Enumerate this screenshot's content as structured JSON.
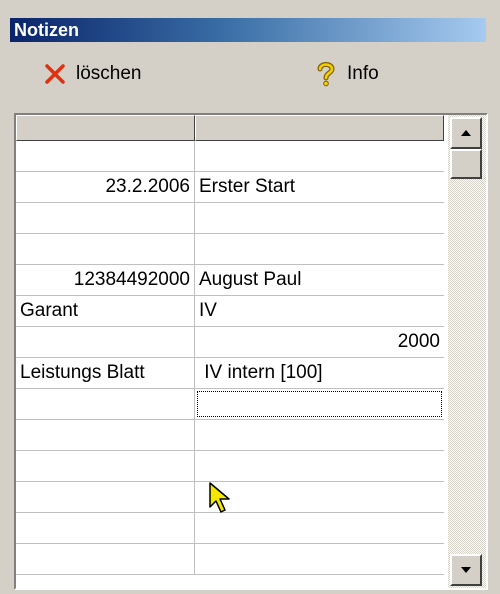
{
  "window": {
    "title": "Notizen"
  },
  "toolbar": {
    "delete_label": "löschen",
    "delete_icon": "delete-x-icon",
    "info_label": "Info",
    "info_icon": "question-mark-icon"
  },
  "grid": {
    "rows": [
      {
        "col1": "",
        "col2": ""
      },
      {
        "col1": "23.2.2006",
        "col2": "Erster Start"
      },
      {
        "col1": "",
        "col2": ""
      },
      {
        "col1": "",
        "col2": ""
      },
      {
        "col1": "12384492000",
        "col2": "August Paul"
      },
      {
        "col1": "Garant",
        "col2": "IV"
      },
      {
        "col1": "",
        "col2": "2000"
      },
      {
        "col1": "Leistungs Blatt",
        "col2": " IV intern [100]"
      },
      {
        "col1": "",
        "col2": ""
      },
      {
        "col1": "",
        "col2": ""
      },
      {
        "col1": "",
        "col2": ""
      },
      {
        "col1": "",
        "col2": ""
      },
      {
        "col1": "",
        "col2": ""
      },
      {
        "col1": "",
        "col2": ""
      }
    ]
  },
  "colors": {
    "delete_x": "#e03010",
    "info_q": "#c8a000",
    "title_start": "#0a246a",
    "title_end": "#a6caf0"
  }
}
